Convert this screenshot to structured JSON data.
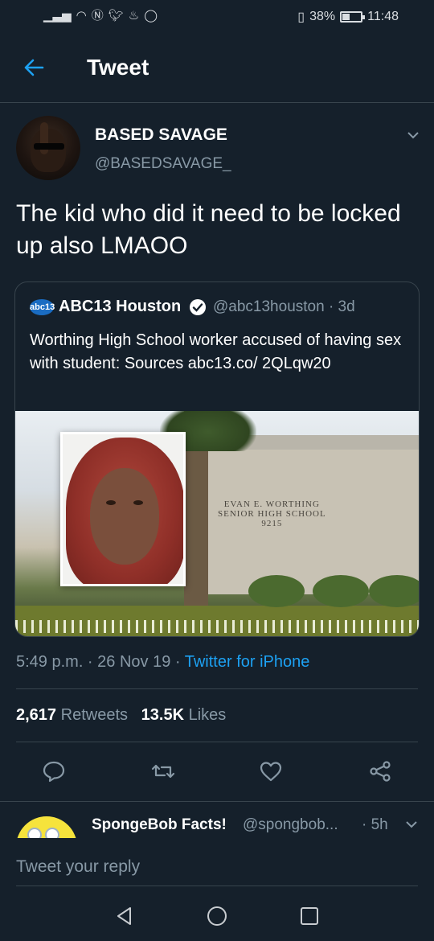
{
  "status_bar": {
    "left_icons": [
      "signal-icon",
      "wifi-icon",
      "nfc-icon",
      "twitter-icon",
      "tinder-icon",
      "whatsapp-icon"
    ],
    "battery": "38%",
    "time": "11:48"
  },
  "header": {
    "title": "Tweet"
  },
  "tweet": {
    "author_name": "BASED SAVAGE",
    "author_handle": "@BASEDSAVAGE_",
    "text": "The kid who did it need to be locked up also LMAOO",
    "timestamp": "5:49 p.m. · 26 Nov 19 · ",
    "source": "Twitter for iPhone",
    "retweets_count": "2,617",
    "retweets_label": "Retweets",
    "likes_count": "13.5K",
    "likes_label": "Likes"
  },
  "quoted_tweet": {
    "logo_text": "abc13",
    "name": "ABC13 Houston",
    "handle_time": "@abc13houston · 3d",
    "text": "Worthing High School worker accused of having sex with student: Sources abc13.co/ 2QLqw20",
    "image_sign": "EVAN E. WORTHING\nSENIOR HIGH SCHOOL\n9215"
  },
  "reply_preview": {
    "name": "SpongeBob Facts!",
    "handle": "@spongbob...",
    "time": "· 5h"
  },
  "reply_input": {
    "placeholder": "Tweet your reply"
  },
  "colors": {
    "background": "#15202b",
    "accent": "#1da1f2",
    "secondary_text": "#8899a6",
    "divider": "#38444d"
  }
}
